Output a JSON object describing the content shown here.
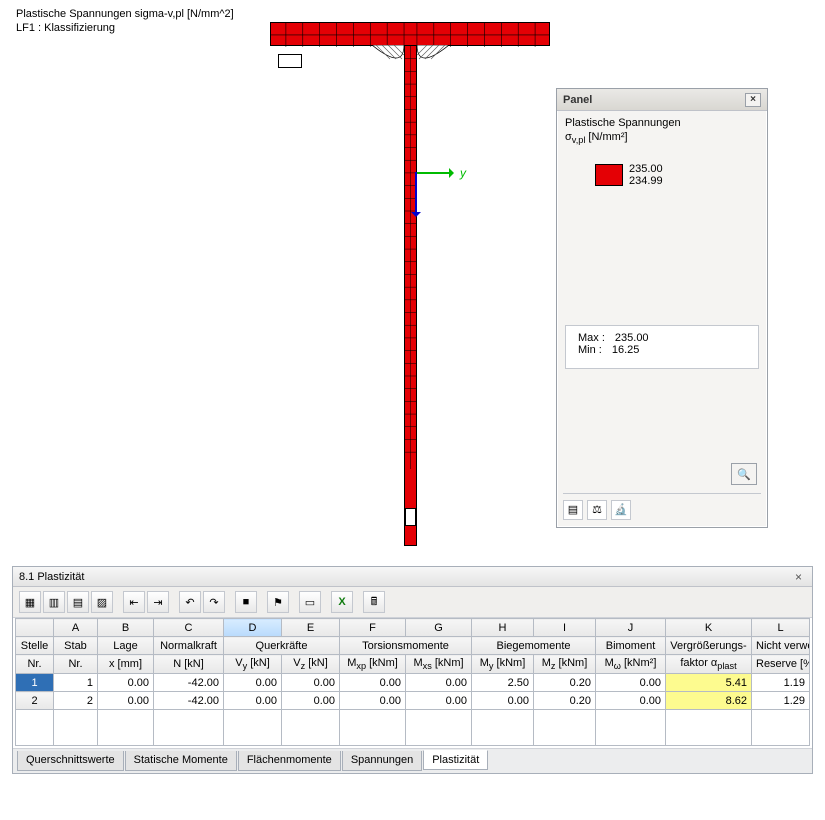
{
  "viewport": {
    "title_line1": "Plastische Spannungen sigma-v,pl [N/mm^2]",
    "title_line2": "LF1 : Klassifizierung",
    "axis_y_label": "y"
  },
  "panel": {
    "title": "Panel",
    "heading": "Plastische Spannungen",
    "sub_html": "σ",
    "sub_idx": "v,pl",
    "sub_unit": " [N/mm²]",
    "legend_high": "235.00",
    "legend_low": "234.99",
    "max_label": "Max  :",
    "max_value": "235.00",
    "min_label": "Min   :",
    "min_value": "16.25"
  },
  "pane": {
    "title": "8.1 Plastizität",
    "col_letters": [
      "",
      "A",
      "B",
      "C",
      "D",
      "E",
      "F",
      "G",
      "H",
      "I",
      "J",
      "K",
      "L"
    ],
    "group_headers": {
      "stelle": "Stelle",
      "stab": "Stab",
      "lage": "Lage",
      "normalkraft": "Normalkraft",
      "querkraefte": "Querkräfte",
      "torsion": "Torsionsmomente",
      "biege": "Biegemomente",
      "bimoment": "Bimoment",
      "vergr": "Vergrößerungs-",
      "reserve": "Nicht verwendete"
    },
    "sub_headers": {
      "nr": "Nr.",
      "stab_nr": "Nr.",
      "x": "x [mm]",
      "N": "N [kN]",
      "Vy": "V_y [kN]",
      "Vz": "V_z [kN]",
      "Mxp": "M_xp [kNm]",
      "Mxs": "M_xs [kNm]",
      "My": "M_y [kNm]",
      "Mz": "M_z [kNm]",
      "Mw": "M_ω [kNm²]",
      "factor": "faktor α_plast",
      "reserve": "Reserve [%]"
    },
    "rows": [
      {
        "nr": "1",
        "stab": "1",
        "x": "0.00",
        "N": "-42.00",
        "Vy": "0.00",
        "Vz": "0.00",
        "Mxp": "0.00",
        "Mxs": "0.00",
        "My": "2.50",
        "Mz": "0.20",
        "Mw": "0.00",
        "factor": "5.41",
        "reserve": "1.19"
      },
      {
        "nr": "2",
        "stab": "2",
        "x": "0.00",
        "N": "-42.00",
        "Vy": "0.00",
        "Vz": "0.00",
        "Mxp": "0.00",
        "Mxs": "0.00",
        "My": "0.00",
        "Mz": "0.20",
        "Mw": "0.00",
        "factor": "8.62",
        "reserve": "1.29"
      }
    ],
    "tabs": [
      "Querschnittswerte",
      "Statische Momente",
      "Flächenmomente",
      "Spannungen",
      "Plastizität"
    ],
    "active_tab": 4
  },
  "icons": {
    "close_x": "×",
    "magnifier": "🔍",
    "rainbow": "▤",
    "balance": "⚖",
    "microscope": "🔬",
    "grid1": "▦",
    "grid2": "▥",
    "grid3": "▤",
    "grid4": "▨",
    "nav1": "⇤",
    "nav2": "⇥",
    "undo": "↶",
    "redo": "↷",
    "color": "■",
    "flag": "⚑",
    "sheet": "▭",
    "xls": "X",
    "calc": "🖩"
  }
}
